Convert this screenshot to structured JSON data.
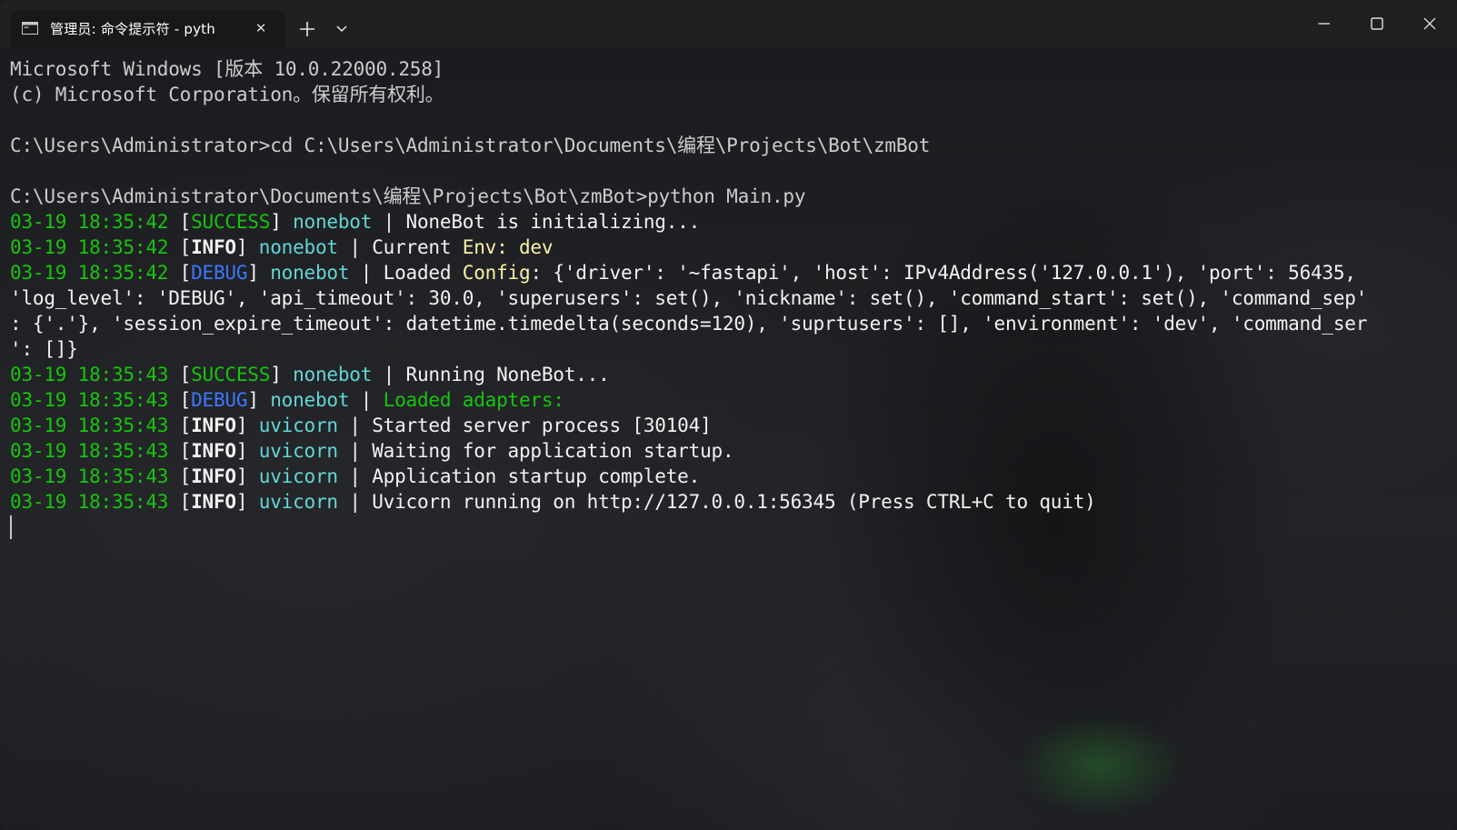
{
  "window": {
    "tab_title": "管理员: 命令提示符 - pyth",
    "tab_close_glyph": "✕",
    "icons": [
      "terminal-icon",
      "close-icon",
      "plus-icon",
      "chevron-down-icon",
      "minimize-icon",
      "maximize-icon",
      "close-window-icon"
    ]
  },
  "terminal": {
    "header_line1": "Microsoft Windows [版本 10.0.22000.258]",
    "header_line2": "(c) Microsoft Corporation。保留所有权利。",
    "prompt1": "C:\\Users\\Administrator>cd C:\\Users\\Administrator\\Documents\\编程\\Projects\\Bot\\zmBot",
    "prompt2": "C:\\Users\\Administrator\\Documents\\编程\\Projects\\Bot\\zmBot>python Main.py",
    "logs": [
      {
        "time": "03-19 18:35:42",
        "level": "SUCCESS",
        "source": "nonebot",
        "msg_a": "NoneBot is initializing...",
        "msg_b": "",
        "msg_c": ""
      },
      {
        "time": "03-19 18:35:42",
        "level": "INFO",
        "source": "nonebot",
        "msg_a": "Current ",
        "msg_b": "Env: dev",
        "msg_c": ""
      },
      {
        "time": "03-19 18:35:42",
        "level": "DEBUG",
        "source": "nonebot",
        "msg_a": "Loaded ",
        "msg_b": "Config",
        "msg_c": ": {'driver': '~fastapi', 'host': IPv4Address('127.0.0.1'), 'port': 56435,"
      },
      {
        "time": "03-19 18:35:43",
        "level": "SUCCESS",
        "source": "nonebot",
        "msg_a": "Running NoneBot...",
        "msg_b": "",
        "msg_c": ""
      },
      {
        "time": "03-19 18:35:43",
        "level": "DEBUG",
        "source": "nonebot",
        "msg_a": "",
        "msg_b": "Loaded adapters:",
        "msg_c": ""
      },
      {
        "time": "03-19 18:35:43",
        "level": "INFO",
        "source": "uvicorn",
        "msg_a": "Started server process [30104]",
        "msg_b": "",
        "msg_c": ""
      },
      {
        "time": "03-19 18:35:43",
        "level": "INFO",
        "source": "uvicorn",
        "msg_a": "Waiting for application startup.",
        "msg_b": "",
        "msg_c": ""
      },
      {
        "time": "03-19 18:35:43",
        "level": "INFO",
        "source": "uvicorn",
        "msg_a": "Application startup complete.",
        "msg_b": "",
        "msg_c": ""
      },
      {
        "time": "03-19 18:35:43",
        "level": "INFO",
        "source": "uvicorn",
        "msg_a": "Uvicorn running on http://127.0.0.1:56345 (Press CTRL+C to quit)",
        "msg_b": "",
        "msg_c": ""
      }
    ],
    "config_cont1": "'log_level': 'DEBUG', 'api_timeout': 30.0, 'superusers': set(), 'nickname': set(), 'command_start': set(), 'command_sep'",
    "config_cont2": ": {'.'}, 'session_expire_timeout': datetime.timedelta(seconds=120), 'suprtusers': [], 'environment': 'dev', 'command_ser",
    "config_cont3": "': []}"
  },
  "colors": {
    "time": "#16c60c",
    "success": "#16c60c",
    "debug": "#3b78ff",
    "source": "#3a96dd",
    "highlight": "#f9f1a5"
  }
}
